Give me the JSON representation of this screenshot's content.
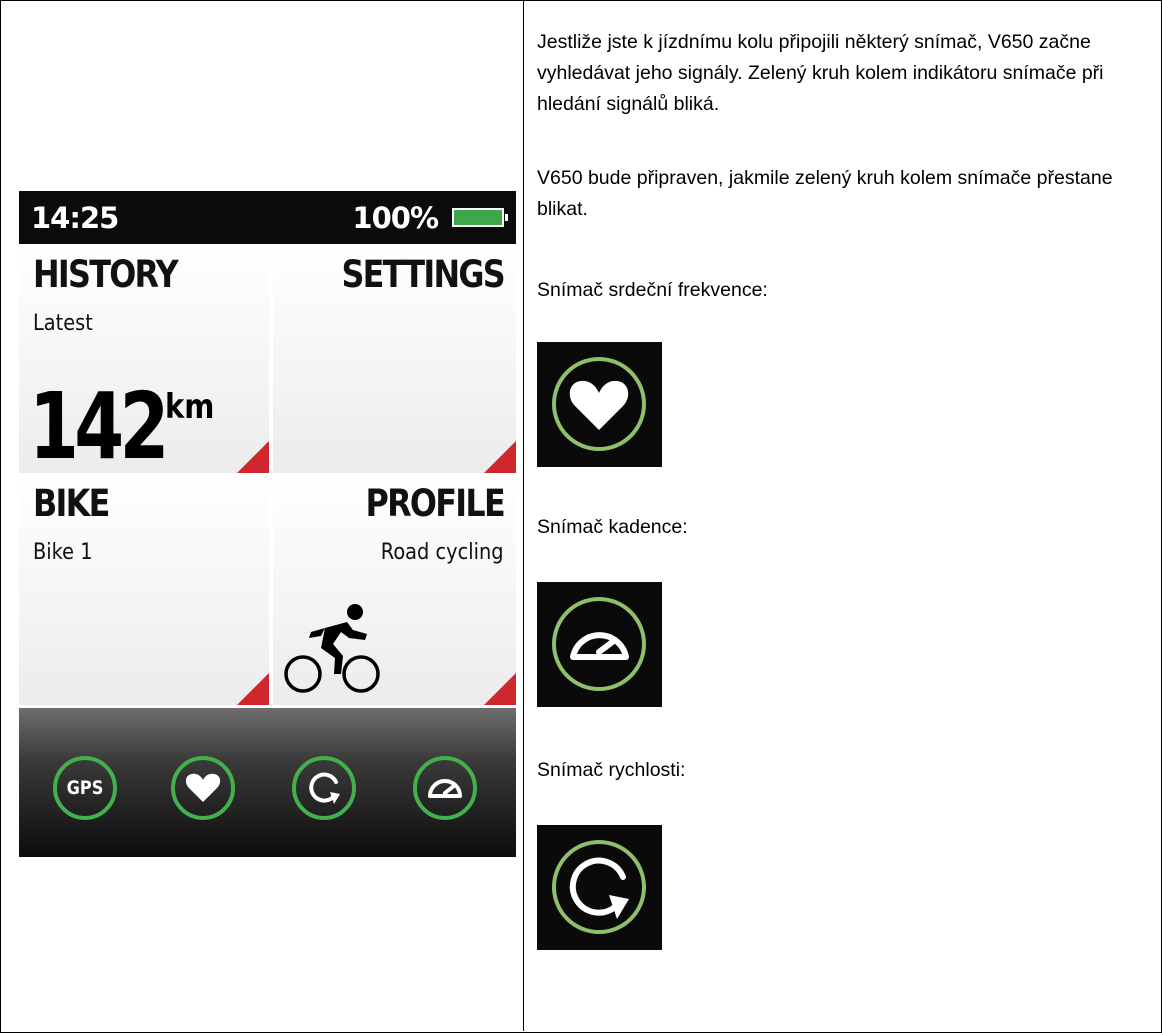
{
  "device": {
    "status": {
      "time": "14:25",
      "battery": "100%"
    },
    "tiles": {
      "history": {
        "title": "HISTORY",
        "subtitle": "Latest",
        "distance": "142",
        "unit": "km"
      },
      "settings": {
        "title": "SETTINGS"
      },
      "bike": {
        "title": "BIKE",
        "subtitle": "Bike 1"
      },
      "profile": {
        "title": "PROFILE",
        "subtitle": "Road cycling"
      }
    },
    "sensors": {
      "gps_label": "GPS"
    },
    "colors": {
      "accent": "#43b14b",
      "corner": "#d0262d",
      "battery": "#3da84a"
    }
  },
  "text": {
    "paragraph1": "Jestliže jste k jízdnímu kolu připojili některý snímač, V650 začne vyhledávat jeho signály. Zelený kruh kolem indikátoru snímače při hledání signálů bliká.",
    "paragraph2": "V650 bude připraven, jakmile zelený kruh kolem snímače přestane blikat.",
    "hr_label": "Snímač srdeční frekvence:",
    "cadence_label": "Snímač kadence:",
    "speed_label": "Snímač rychlosti:"
  }
}
